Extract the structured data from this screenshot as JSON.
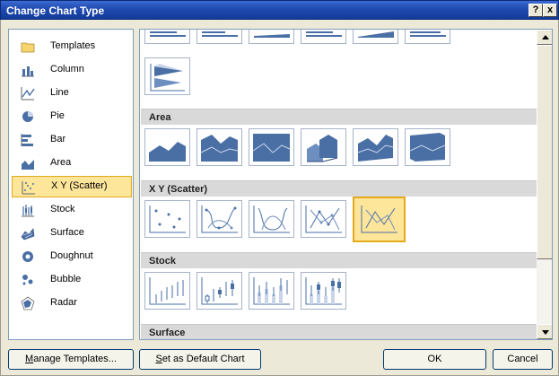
{
  "window": {
    "title": "Change Chart Type",
    "help_glyph": "?",
    "close_glyph": "x"
  },
  "categories": [
    {
      "label": "Templates",
      "icon": "folder-icon",
      "selected": false
    },
    {
      "label": "Column",
      "icon": "column-chart-icon",
      "selected": false
    },
    {
      "label": "Line",
      "icon": "line-chart-icon",
      "selected": false
    },
    {
      "label": "Pie",
      "icon": "pie-chart-icon",
      "selected": false
    },
    {
      "label": "Bar",
      "icon": "bar-chart-icon",
      "selected": false
    },
    {
      "label": "Area",
      "icon": "area-chart-icon",
      "selected": false
    },
    {
      "label": "X Y (Scatter)",
      "icon": "scatter-chart-icon",
      "selected": true
    },
    {
      "label": "Stock",
      "icon": "stock-chart-icon",
      "selected": false
    },
    {
      "label": "Surface",
      "icon": "surface-chart-icon",
      "selected": false
    },
    {
      "label": "Doughnut",
      "icon": "doughnut-chart-icon",
      "selected": false
    },
    {
      "label": "Bubble",
      "icon": "bubble-chart-icon",
      "selected": false
    },
    {
      "label": "Radar",
      "icon": "radar-chart-icon",
      "selected": false
    }
  ],
  "sections": {
    "area": "Area",
    "scatter": "X Y (Scatter)",
    "stock": "Stock",
    "surface": "Surface"
  },
  "thumbnails": {
    "bar_partial": [
      "bar-thumb",
      "bar-thumb",
      "bar-thumb",
      "bar-thumb",
      "bar-thumb",
      "bar-thumb"
    ],
    "bar_3d": "3d-cone-bar-thumb",
    "area": [
      "area-thumb",
      "stacked-area-thumb",
      "100-stacked-area-thumb",
      "3d-area-thumb",
      "3d-stacked-area-thumb",
      "3d-100-stacked-area-thumb"
    ],
    "scatter": [
      "scatter-markers-thumb",
      "scatter-smooth-markers-thumb",
      "scatter-smooth-thumb",
      "scatter-straight-markers-thumb",
      "scatter-straight-thumb"
    ],
    "scatter_selected_index": 4,
    "stock": [
      "high-low-close-thumb",
      "open-high-low-close-thumb",
      "volume-high-low-close-thumb",
      "volume-open-high-low-close-thumb"
    ]
  },
  "buttons": {
    "manage_accel": "M",
    "manage_rest": "anage Templates...",
    "default_accel": "S",
    "default_rest": "et as Default Chart",
    "ok": "OK",
    "cancel": "Cancel"
  },
  "colors": {
    "title_bar": "#1f4ab0",
    "selection_fill": "#fde59a",
    "selection_border": "#e5a91c",
    "thumb_blue": "#4a6fa5"
  }
}
